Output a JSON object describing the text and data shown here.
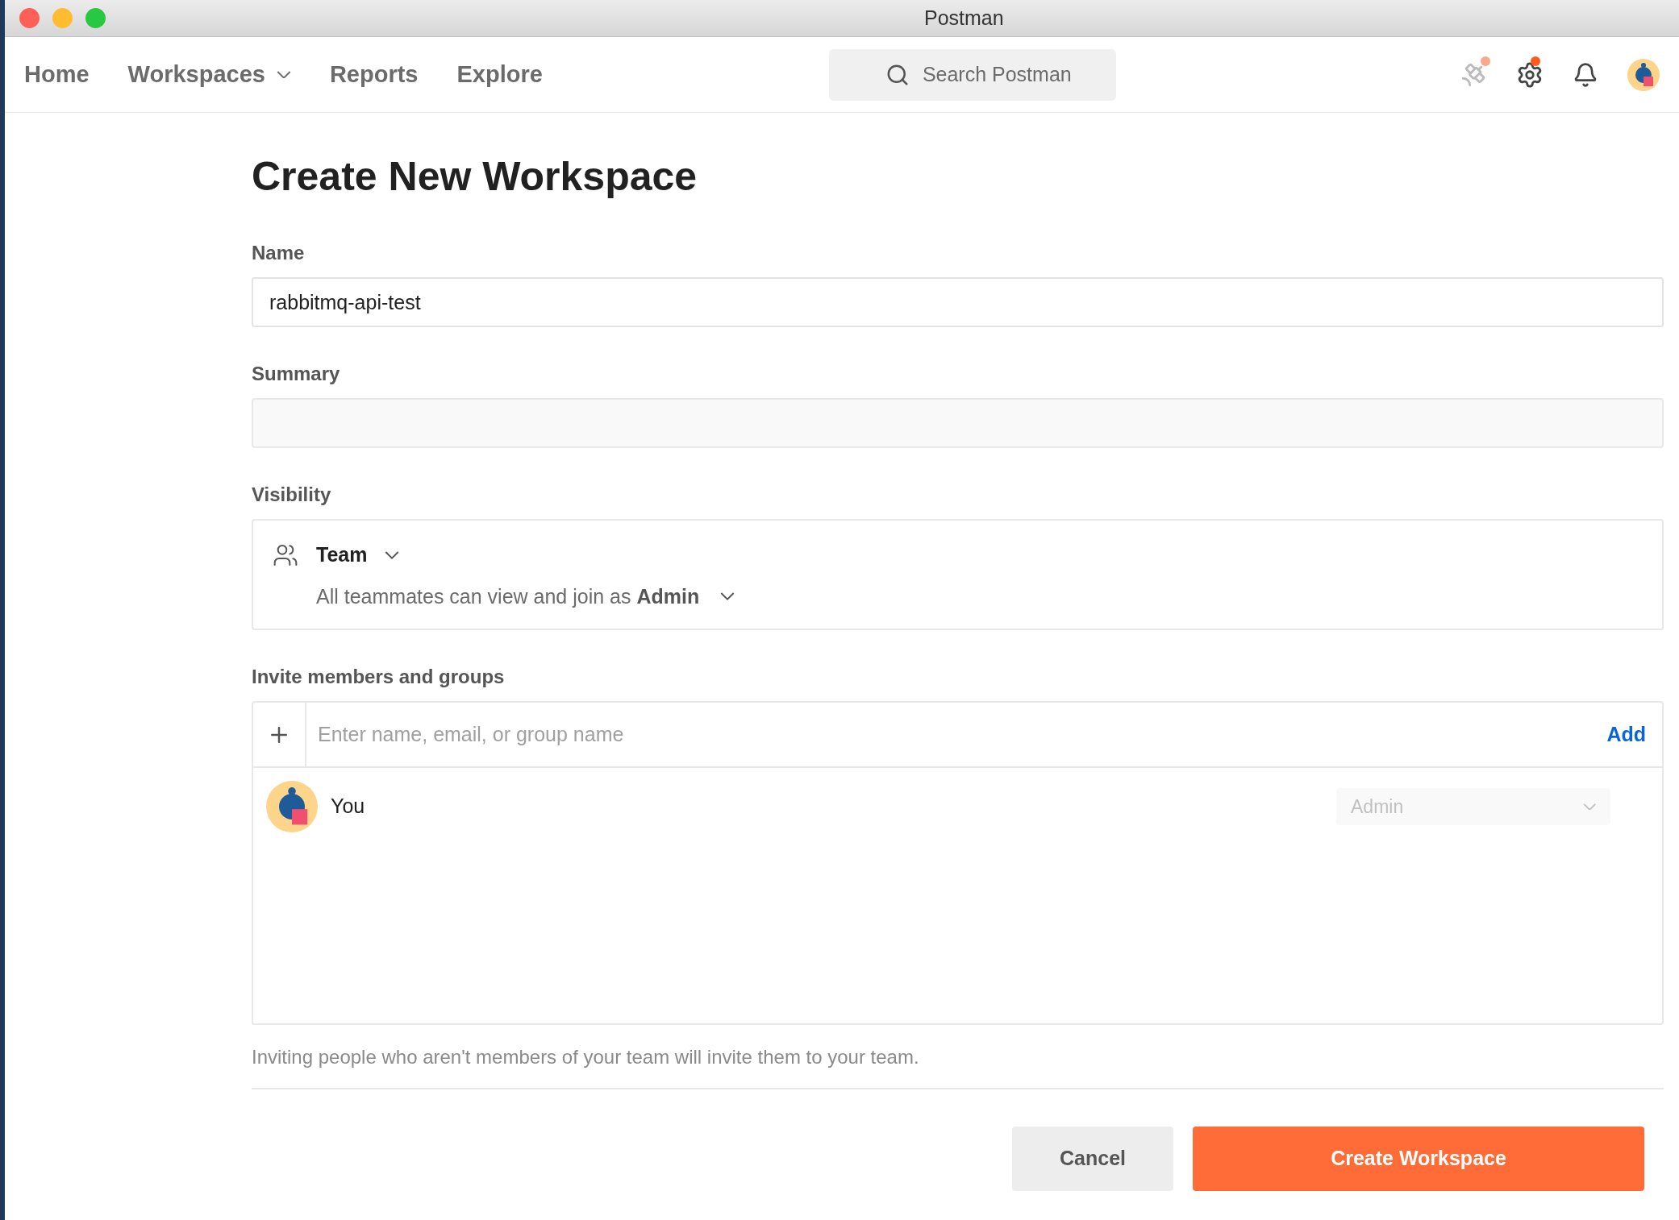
{
  "window": {
    "title": "Postman"
  },
  "nav": {
    "items": [
      {
        "label": "Home",
        "dropdown": false
      },
      {
        "label": "Workspaces",
        "dropdown": true
      },
      {
        "label": "Reports",
        "dropdown": false
      },
      {
        "label": "Explore",
        "dropdown": false
      }
    ],
    "search": {
      "placeholder": "Search Postman"
    }
  },
  "form": {
    "title": "Create New Workspace",
    "name": {
      "label": "Name",
      "value": "rabbitmq-api-test"
    },
    "summary": {
      "label": "Summary"
    },
    "visibility": {
      "label": "Visibility",
      "type": "Team",
      "description": "All teammates can view and join as **Admin**"
    },
    "invite": {
      "label": "Invite members and groups",
      "placeholder": "Enter name, email, or group name",
      "add": "Add",
      "members": [
        {
          "name": "You",
          "role": "Admin",
          "disabled": true
        }
      ]
    },
    "note": "Inviting people who aren't members of your team will invite them to your team.",
    "buttons": [
      {
        "label": "Cancel",
        "kind": "secondary"
      },
      {
        "label": "Create Workspace",
        "kind": "primary"
      }
    ]
  }
}
